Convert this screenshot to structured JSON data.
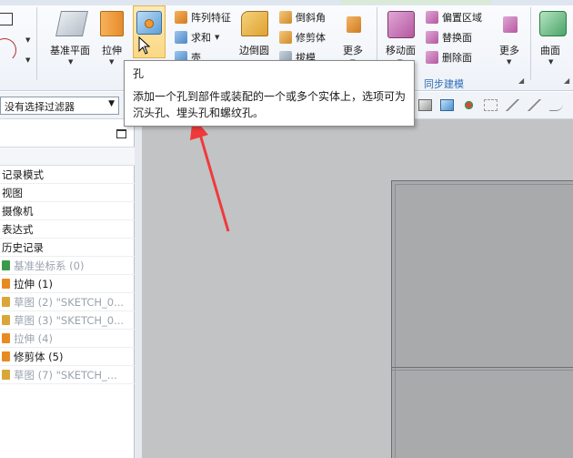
{
  "ribbon": {
    "datum_plane": "基准平面",
    "extrude": "拉伸",
    "pattern_feature": "阵列特征",
    "unite": "求和",
    "shell": "壳",
    "edge_blend": "边倒圆",
    "chamfer": "倒斜角",
    "trim_body": "修剪体",
    "draft": "拔模",
    "more1": "更多",
    "move_face": "移动面",
    "offset_region": "偏置区域",
    "replace_face": "替换面",
    "delete_face": "删除面",
    "more2": "更多",
    "surface": "曲面",
    "sync_modeling_group": "同步建模"
  },
  "filter": {
    "selection_filter": "没有选择过滤器"
  },
  "navigator": {
    "rows": [
      {
        "label": "记录模式",
        "dim": false
      },
      {
        "label": "视图",
        "dim": false
      },
      {
        "label": "摄像机",
        "dim": false
      },
      {
        "label": "表达式",
        "dim": false
      },
      {
        "label": "历史记录",
        "dim": false
      },
      {
        "label": "基准坐标系 (0)",
        "dim": true
      },
      {
        "label": "拉伸 (1)",
        "dim": false
      },
      {
        "label": "草图 (2) \"SKETCH_0...",
        "dim": true
      },
      {
        "label": "草图 (3) \"SKETCH_0...",
        "dim": true
      },
      {
        "label": "拉伸 (4)",
        "dim": true
      },
      {
        "label": "修剪体 (5)",
        "dim": false
      },
      {
        "label": "草图 (7) \"SKETCH_...",
        "dim": true
      }
    ]
  },
  "tooltip": {
    "title": "孔",
    "line1": "添加一个孔到部件或装配的一个或多个实体上，选项可为",
    "line2": "沉头孔、埋头孔和螺纹孔。"
  },
  "colors": {
    "annotation_arrow": "#f03a3a",
    "viewport_bg": "#c2c3c5",
    "part_face": "#a9aaac",
    "ribbon_group_label": "#2f6db5"
  }
}
